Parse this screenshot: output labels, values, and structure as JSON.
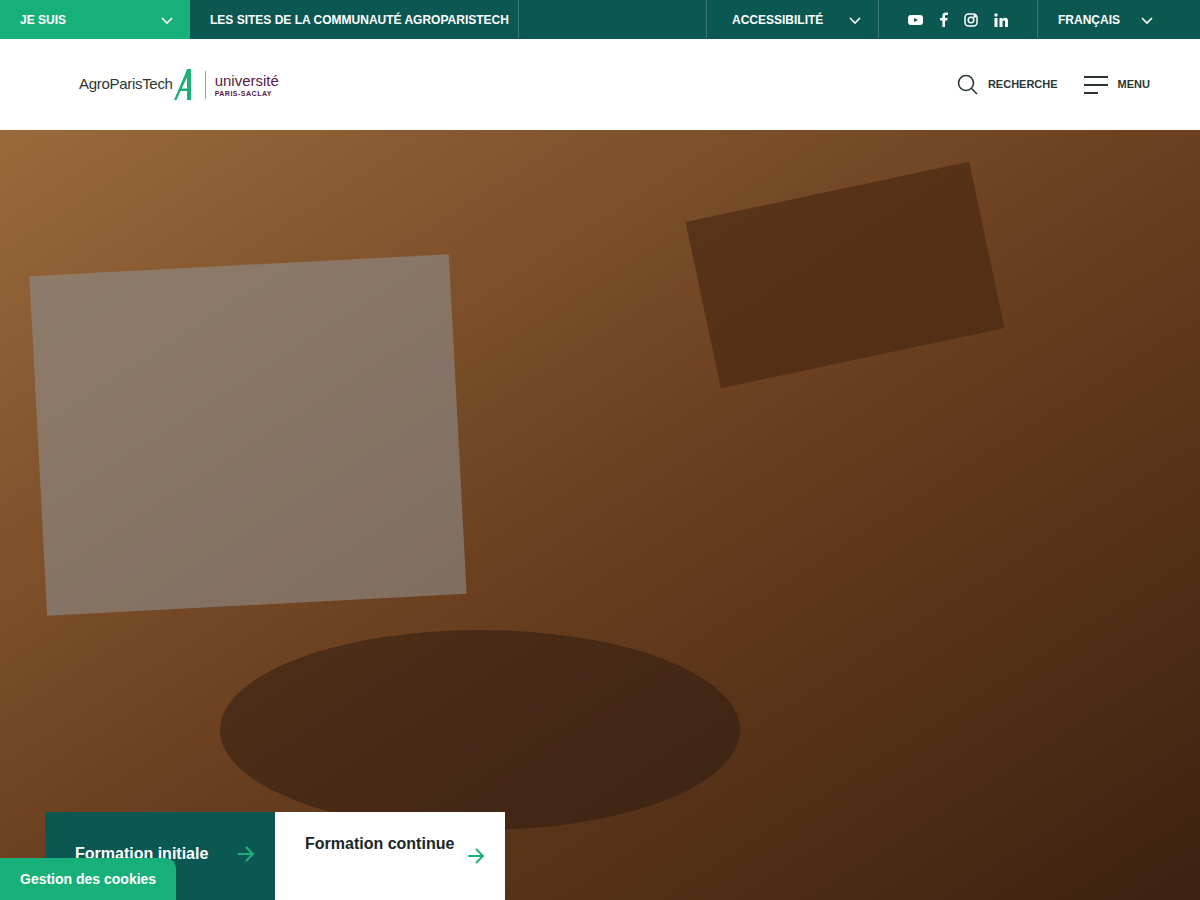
{
  "topbar": {
    "profile": {
      "label": "JE SUIS"
    },
    "sites": {
      "label": "LES SITES DE LA COMMUNAUTÉ AGROPARISTECH"
    },
    "accessibility": {
      "label": "ACCESSIBILITÉ"
    },
    "language": {
      "label": "FRANÇAIS"
    }
  },
  "header": {
    "logo": {
      "name": "AgroParisTech",
      "partner": "université",
      "partner_sub": "PARIS-SACLAY"
    },
    "search": {
      "label": "RECHERCHE"
    },
    "menu": {
      "label": "MENU"
    }
  },
  "hero": {
    "cards": [
      {
        "label": "Formation initiale",
        "kind": "dark"
      },
      {
        "label": "Formation continue",
        "kind": "light"
      }
    ]
  },
  "cookies": {
    "label": "Gestion des cookies"
  }
}
